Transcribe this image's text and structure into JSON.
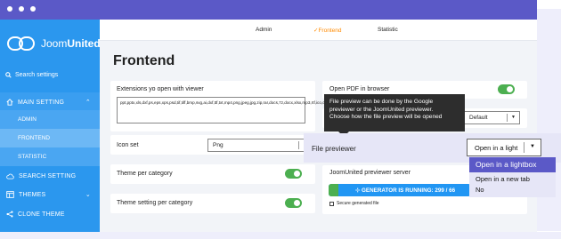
{
  "brand": {
    "name_light": "Joom",
    "name_bold": "United"
  },
  "sidebar": {
    "search_label": "Search settings",
    "main_setting": "MAIN SETTING",
    "items": [
      {
        "label": "ADMIN"
      },
      {
        "label": "FRONTEND"
      },
      {
        "label": "STATISTIC"
      }
    ],
    "search_setting": "SEARCH SETTING",
    "themes": "THEMES",
    "clone_theme": "CLONE THEME"
  },
  "tabs": {
    "admin": "Admin",
    "frontend": "✓Frontend",
    "statistic": "Statistic"
  },
  "page": {
    "title": "Frontend"
  },
  "settings": {
    "extensions_label": "Extensions yo open with viewer",
    "extensions_value": "ppt,pptx,xls,dxf,ps,eps,xps,psd,tif,tiff,bmp,svg,ai,dxf,ttf,txt,mp4,png,jpeg,jpg,zip,rar,docs,7z,docx,xlsx,mp3,rtf,ico,csv",
    "icon_set_label": "Icon set",
    "icon_set_value": "Png",
    "theme_per_category_label": "Theme per category",
    "theme_setting_per_category_label": "Theme setting per category",
    "open_pdf_label": "Open PDF in browser",
    "default_value": "Default",
    "file_previewer_label": "File previewer",
    "file_previewer_value": "Open in a light",
    "server_label": "JoomUnited previewer server",
    "progress_text": "GENERATOR IS RUNNING: 299 / 66",
    "secure_label": "Secure generated file"
  },
  "toggles": {
    "open_pdf": true,
    "theme_per_category": true,
    "theme_setting_per_category": true
  },
  "tooltip": {
    "line1": "File preview can be done by the Google",
    "line2": "previewer or the JoomUnited previewer.",
    "line3": "Choose how the file preview will be opened"
  },
  "dropdown_options": [
    {
      "label": "Open in a lightbox"
    },
    {
      "label": "Open in a new tab"
    },
    {
      "label": "No"
    }
  ],
  "colors": {
    "frame": "#5b59c7",
    "sidebar": "#2b97ee",
    "accent_tab": "#ff8a00",
    "toggle_on": "#4caf50",
    "progress": "#2196f3"
  }
}
